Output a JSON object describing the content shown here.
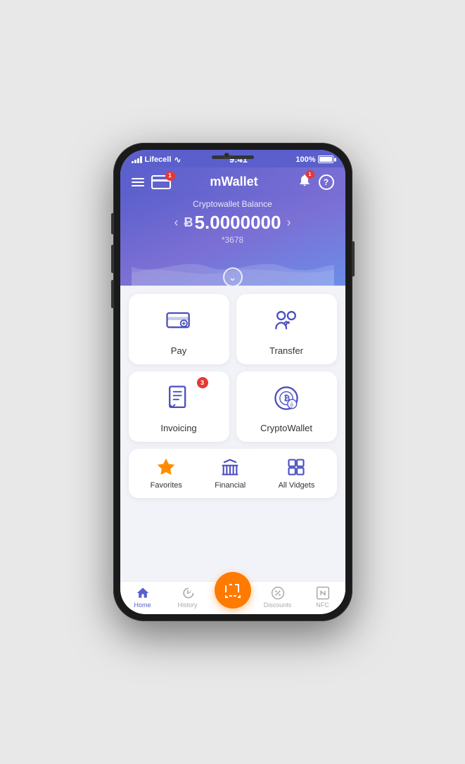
{
  "status": {
    "carrier": "Lifecell",
    "time": "9:41",
    "battery": "100%"
  },
  "header": {
    "title": "mWallet",
    "card_badge": "1"
  },
  "balance": {
    "label": "Cryptowallet Balance",
    "currency_symbol": "Ƀ",
    "amount": "5.0000000",
    "account_mask": "*3678"
  },
  "actions": [
    {
      "id": "pay",
      "label": "Pay",
      "icon": "pay"
    },
    {
      "id": "transfer",
      "label": "Transfer",
      "icon": "transfer"
    },
    {
      "id": "invoicing",
      "label": "Invoicing",
      "icon": "invoicing",
      "badge": "3"
    },
    {
      "id": "cryptowallet",
      "label": "CryptoWallet",
      "icon": "crypto"
    }
  ],
  "widgets": [
    {
      "id": "favorites",
      "label": "Favorites",
      "icon": "star"
    },
    {
      "id": "financial",
      "label": "Financial",
      "icon": "bank"
    },
    {
      "id": "all-vidgets",
      "label": "All Vidgets",
      "icon": "grid"
    }
  ],
  "nav": [
    {
      "id": "home",
      "label": "Home",
      "icon": "home",
      "active": true
    },
    {
      "id": "history",
      "label": "History",
      "icon": "clock",
      "active": false
    },
    {
      "id": "scan",
      "label": "",
      "icon": "scan",
      "active": false,
      "special": true
    },
    {
      "id": "discounts",
      "label": "Discounts",
      "icon": "discount",
      "active": false
    },
    {
      "id": "nfc",
      "label": "NFC",
      "icon": "nfc",
      "active": false
    }
  ]
}
